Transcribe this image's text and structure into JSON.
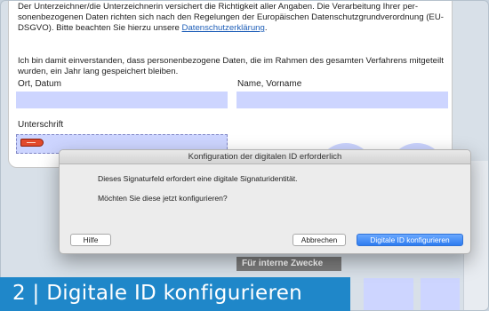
{
  "document": {
    "paragraph1_a": "Der Unterzeichner/die Unterzeichnerin versichert die Richtigkeit aller Angaben. Die Verarbeitung Ihrer per-sonenbezogenen Daten richten sich nach den Regelungen der Europäischen Datenschutzgrundverordnung (EU-DSGVO). Bitte beachten Sie hierzu unsere ",
    "privacy_link": "Datenschutzerklärung",
    "paragraph1_b": ".",
    "paragraph2": "Ich bin damit einverstanden, dass personenbezogene Daten, die im Rahmen des gesamten Verfahrens mitgeteilt wurden, ein Jahr lang gespeichert bleiben.",
    "label_place_date": "Ort, Datum",
    "label_name": "Name, Vorname",
    "label_signature": "Unterschrift",
    "internal_header": "Für interne Zwecke"
  },
  "dialog": {
    "title": "Konfiguration der digitalen ID erforderlich",
    "message1": "Dieses Signaturfeld erfordert eine digitale Signaturidentität.",
    "message2": "Möchten Sie diese jetzt konfigurieren?",
    "help_label": "Hilfe",
    "cancel_label": "Abbrechen",
    "configure_label": "Digitale ID konfigurieren"
  },
  "banner": {
    "text": "2 | Digitale ID konfigurieren"
  },
  "colors": {
    "field_fill": "#cdd5ff",
    "link": "#1f5fb8",
    "banner": "#1f87c9",
    "primary_button": "#2d7cf0",
    "signature_flag": "#e24a2c"
  },
  "icons": {
    "signature_flag": "signature-flag-icon"
  }
}
